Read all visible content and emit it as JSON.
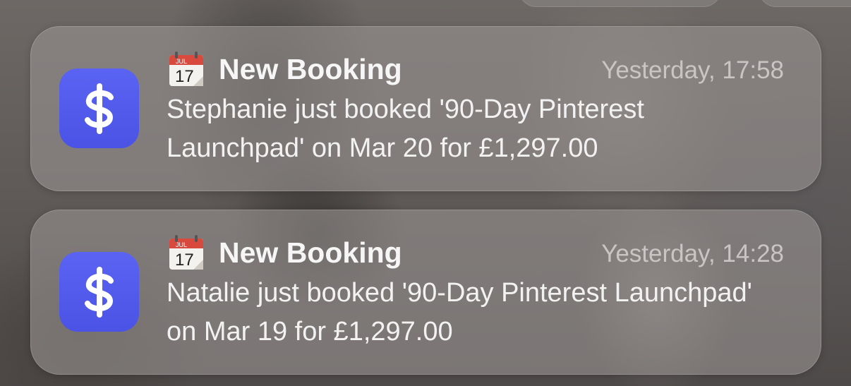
{
  "notifications": [
    {
      "app_icon": "dollar-sign-icon",
      "app_icon_color": "#525BEE",
      "title_icon": "calendar-icon",
      "calendar_month": "JUL",
      "calendar_day": "17",
      "title": "New Booking",
      "time": "Yesterday, 17:58",
      "message": "Stephanie just booked '90-Day Pinterest Launchpad' on Mar 20 for £1,297.00"
    },
    {
      "app_icon": "dollar-sign-icon",
      "app_icon_color": "#525BEE",
      "title_icon": "calendar-icon",
      "calendar_month": "JUL",
      "calendar_day": "17",
      "title": "New Booking",
      "time": "Yesterday, 14:28",
      "message": "Natalie just booked '90-Day Pinterest Launchpad' on Mar 19 for £1,297.00"
    }
  ]
}
